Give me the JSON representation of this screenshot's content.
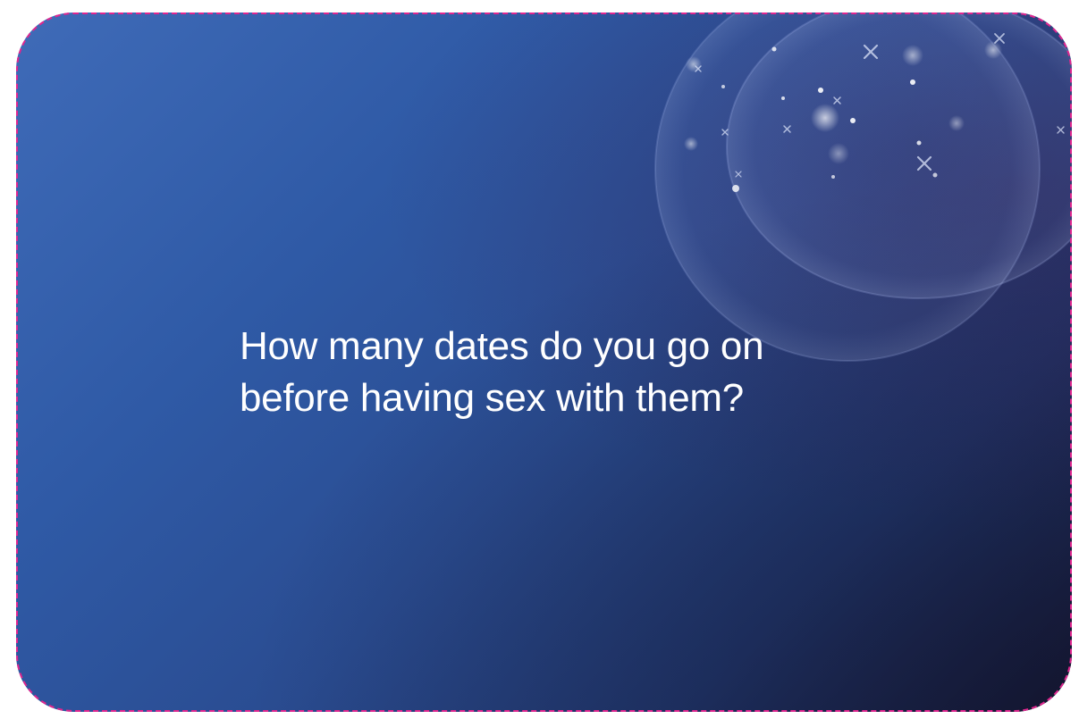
{
  "card": {
    "question_lines": [
      "How many dates do you go on",
      "before having sex with them?"
    ]
  },
  "colors": {
    "background_start": "#3f6bb8",
    "background_end": "#181c3c",
    "text": "#ffffff",
    "cut_line": "#e0268f"
  },
  "decorations": {
    "icon": "bubble-cluster-icon"
  }
}
